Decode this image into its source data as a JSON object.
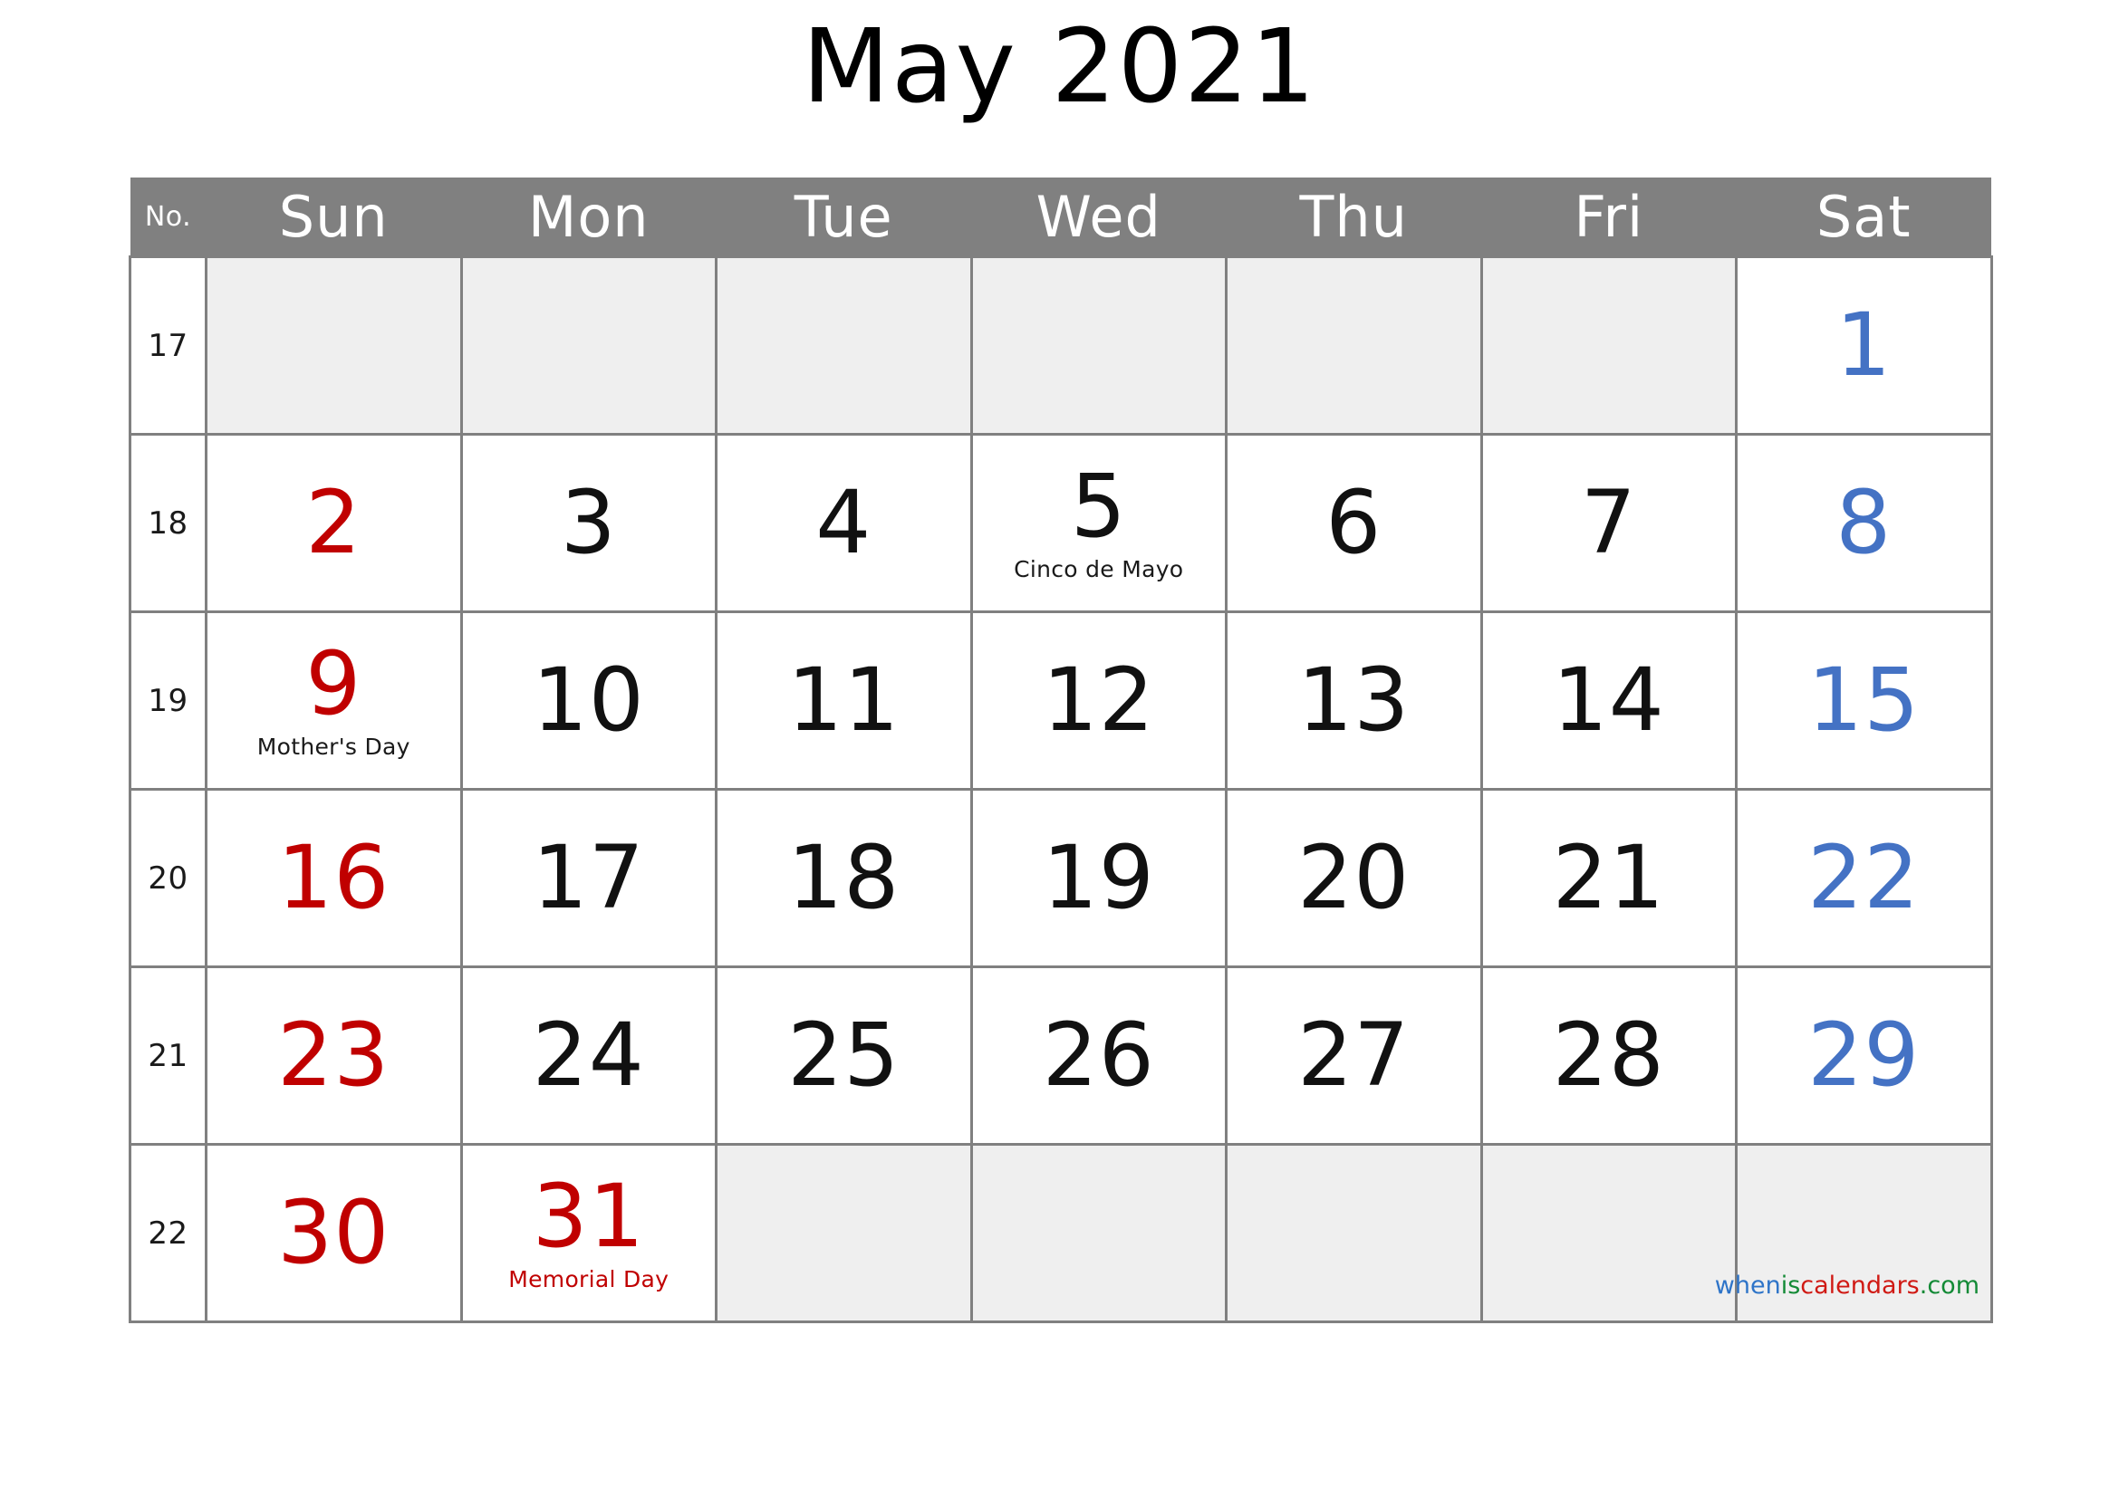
{
  "title": "May 2021",
  "table": {
    "headers": [
      "No.",
      "Sun",
      "Mon",
      "Tue",
      "Wed",
      "Thu",
      "Fri",
      "Sat"
    ],
    "week_numbers": [
      "17",
      "18",
      "19",
      "20",
      "21",
      "22"
    ],
    "weeks": [
      {
        "no": "17",
        "days": [
          {
            "num": "",
            "empty": true
          },
          {
            "num": "",
            "empty": true
          },
          {
            "num": "",
            "empty": true
          },
          {
            "num": "",
            "empty": true
          },
          {
            "num": "",
            "empty": true
          },
          {
            "num": "",
            "empty": true
          },
          {
            "num": "1",
            "empty": false,
            "color": "sat"
          }
        ]
      },
      {
        "no": "18",
        "days": [
          {
            "num": "2",
            "empty": false,
            "color": "sun"
          },
          {
            "num": "3",
            "empty": false,
            "color": "wk"
          },
          {
            "num": "4",
            "empty": false,
            "color": "wk"
          },
          {
            "num": "5",
            "empty": false,
            "color": "wk",
            "holiday": "Cinco de Mayo"
          },
          {
            "num": "6",
            "empty": false,
            "color": "wk"
          },
          {
            "num": "7",
            "empty": false,
            "color": "wk"
          },
          {
            "num": "8",
            "empty": false,
            "color": "sat"
          }
        ]
      },
      {
        "no": "19",
        "days": [
          {
            "num": "9",
            "empty": false,
            "color": "sun",
            "holiday": "Mother's Day"
          },
          {
            "num": "10",
            "empty": false,
            "color": "wk"
          },
          {
            "num": "11",
            "empty": false,
            "color": "wk"
          },
          {
            "num": "12",
            "empty": false,
            "color": "wk"
          },
          {
            "num": "13",
            "empty": false,
            "color": "wk"
          },
          {
            "num": "14",
            "empty": false,
            "color": "wk"
          },
          {
            "num": "15",
            "empty": false,
            "color": "sat"
          }
        ]
      },
      {
        "no": "20",
        "days": [
          {
            "num": "16",
            "empty": false,
            "color": "sun"
          },
          {
            "num": "17",
            "empty": false,
            "color": "wk"
          },
          {
            "num": "18",
            "empty": false,
            "color": "wk"
          },
          {
            "num": "19",
            "empty": false,
            "color": "wk"
          },
          {
            "num": "20",
            "empty": false,
            "color": "wk"
          },
          {
            "num": "21",
            "empty": false,
            "color": "wk"
          },
          {
            "num": "22",
            "empty": false,
            "color": "sat"
          }
        ]
      },
      {
        "no": "21",
        "days": [
          {
            "num": "23",
            "empty": false,
            "color": "sun"
          },
          {
            "num": "24",
            "empty": false,
            "color": "wk"
          },
          {
            "num": "25",
            "empty": false,
            "color": "wk"
          },
          {
            "num": "26",
            "empty": false,
            "color": "wk"
          },
          {
            "num": "27",
            "empty": false,
            "color": "wk"
          },
          {
            "num": "28",
            "empty": false,
            "color": "wk"
          },
          {
            "num": "29",
            "empty": false,
            "color": "sat"
          }
        ]
      },
      {
        "no": "22",
        "days": [
          {
            "num": "30",
            "empty": false,
            "color": "sun"
          },
          {
            "num": "31",
            "empty": false,
            "color": "hol",
            "holiday": "Memorial Day",
            "holiday_red": true
          },
          {
            "num": "",
            "empty": true
          },
          {
            "num": "",
            "empty": true
          },
          {
            "num": "",
            "empty": true
          },
          {
            "num": "",
            "empty": true
          },
          {
            "num": "",
            "empty": true
          }
        ]
      }
    ]
  },
  "watermark": {
    "part1": "when",
    "part2": "is",
    "part3": "calendars",
    "part4": ".com"
  },
  "colors": {
    "header_bg": "#808080",
    "grid_border": "#808080",
    "empty_cell_bg": "#efefef",
    "sunday": "#C00000",
    "saturday": "#4472C4",
    "weekday": "#111111",
    "watermark_blue": "#2E74C8",
    "watermark_green": "#138A36",
    "watermark_red": "#D01A14"
  }
}
